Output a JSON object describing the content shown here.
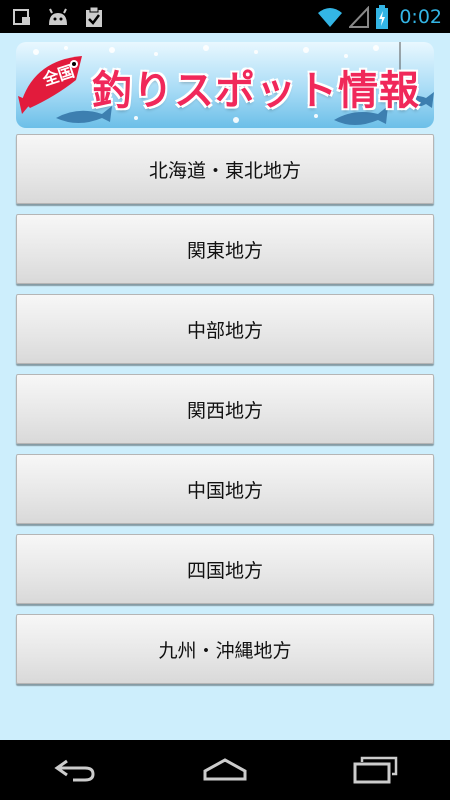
{
  "status_bar": {
    "time": "0:02",
    "icons": [
      "notification-square-icon",
      "android-icon",
      "clipboard-check-icon",
      "wifi-icon",
      "signal-icon",
      "battery-charging-icon"
    ]
  },
  "banner": {
    "badge": "全国",
    "title": "釣りスポット情報"
  },
  "regions": [
    {
      "label": "北海道・東北地方"
    },
    {
      "label": "関東地方"
    },
    {
      "label": "中部地方"
    },
    {
      "label": "関西地方"
    },
    {
      "label": "中国地方"
    },
    {
      "label": "四国地方"
    },
    {
      "label": "九州・沖縄地方"
    }
  ],
  "nav_bar": {
    "icons": [
      "back-icon",
      "home-icon",
      "recent-apps-icon"
    ]
  },
  "colors": {
    "background": "#cdeefc",
    "title": "#f0285a",
    "clock": "#33b5e5"
  }
}
